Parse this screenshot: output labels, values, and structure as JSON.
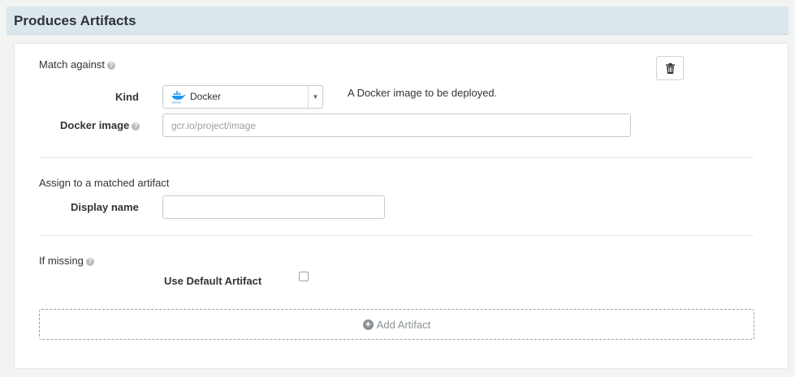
{
  "section": {
    "title": "Produces Artifacts"
  },
  "match": {
    "label": "Match against",
    "help_icon": "question-circle-icon",
    "delete_icon": "trash-icon",
    "kind": {
      "label": "Kind",
      "selected": "Docker",
      "logo_icon": "docker-logo-icon",
      "logo_text": "docker",
      "description": "A Docker image to be deployed."
    },
    "docker_image": {
      "label": "Docker image",
      "value": "",
      "placeholder": "gcr.io/project/image"
    }
  },
  "assign": {
    "label": "Assign to a matched artifact",
    "display_name": {
      "label": "Display name",
      "value": ""
    }
  },
  "missing": {
    "label": "If missing",
    "use_default": {
      "label": "Use Default Artifact",
      "checked": false
    }
  },
  "add_artifact": {
    "label": "Add Artifact",
    "icon": "plus-circle-icon"
  },
  "colors": {
    "header_bg": "#dbe7ec",
    "docker_blue": "#2496ed"
  }
}
